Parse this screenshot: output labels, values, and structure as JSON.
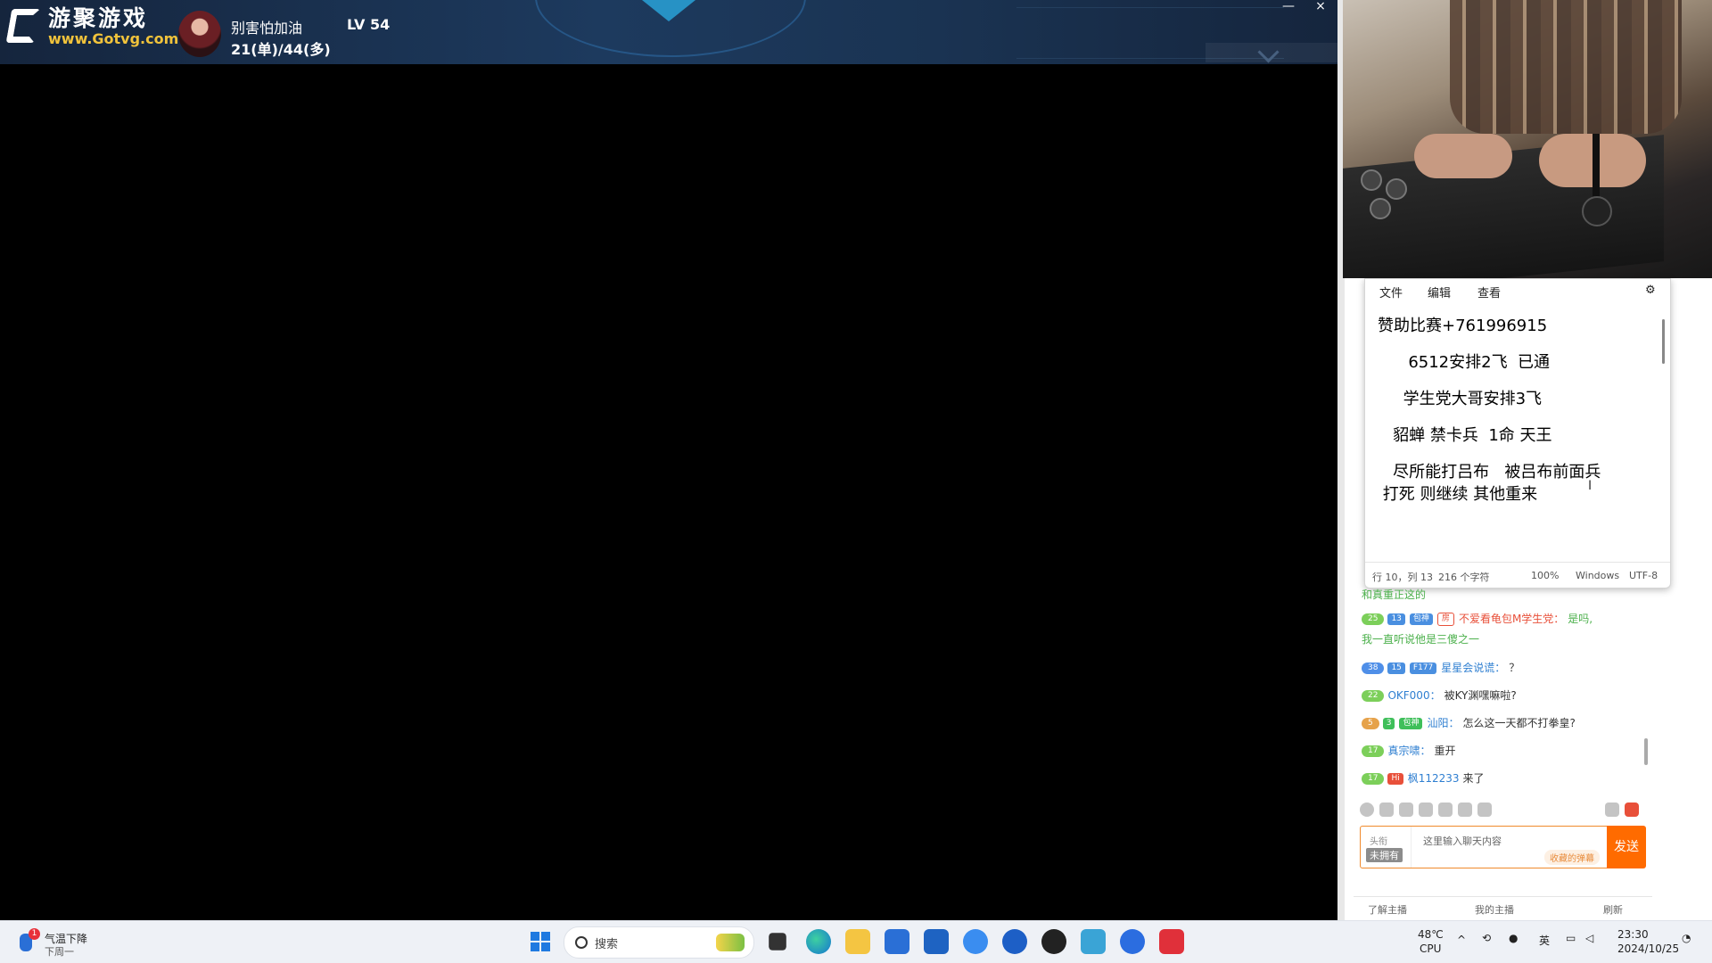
{
  "game": {
    "logo_cn": "游聚游戏",
    "logo_url": "www.Gotvg.com",
    "player_name": "别害怕加油",
    "player_record": "21(单)/44(多)",
    "player_level": "LV 54",
    "minimize_label": "—",
    "close_label": "×"
  },
  "notepad": {
    "menu": [
      "文件",
      "编辑",
      "查看"
    ],
    "lines": [
      "赞助比赛+761996915",
      "      6512安排2飞  已通",
      "     学生党大哥安排3飞",
      "   貂蝉 禁卡兵  1命 天王",
      "   尽所能打吕布   被吕布前面兵",
      " 打死 则继续 其他重来"
    ],
    "status": {
      "position": "行 10，列 13",
      "chars": "216 个字符",
      "zoom": "100%",
      "eol": "Windows",
      "encoding": "UTF-8"
    }
  },
  "chat": {
    "partial_text": "和真重正这的 ",
    "messages": [
      {
        "level": "25",
        "level_color": "#7ccf5a",
        "fan_level": "13",
        "fan_name": "包神",
        "fan_color": "#4a8fe0",
        "room_badge": "房",
        "user": "不爱看龟包M学生党：",
        "user_color": "#e8503a",
        "text": "是吗,",
        "text_color": "#e8503a",
        "text2": "我一直听说他是三傻之一",
        "text2_color": "#4bb04b"
      },
      {
        "level": "38",
        "level_color": "#4f8fe8",
        "fan_level": "15",
        "fan_name": "F177",
        "fan_color": "#4a8fe0",
        "user": "星星会说谎：",
        "user_color": "#2f7fd1",
        "text": "？",
        "text_color": "#333"
      },
      {
        "level": "22",
        "level_color": "#7ccf5a",
        "user": "OKF000：",
        "user_color": "#2f7fd1",
        "text": "被KY渊嘿嘛啦?",
        "text_color": "#333"
      },
      {
        "level": "5",
        "level_color": "#e6a24a",
        "fan_level": "3",
        "fan_name": "包神",
        "fan_color": "#3fbf5a",
        "user": "汕阳：",
        "user_color": "#2f7fd1",
        "text": "怎么这一天都不打拳皇?",
        "text_color": "#333"
      },
      {
        "level": "17",
        "level_color": "#7ccf5a",
        "user": "真宗啸：",
        "user_color": "#2f7fd1",
        "text": "重开",
        "text_color": "#333"
      },
      {
        "level": "17",
        "level_color": "#7ccf5a",
        "hi_badge": "Hi",
        "user": "枫112233",
        "user_color": "#2f7fd1",
        "text": "来了",
        "text_color": "#333"
      }
    ],
    "input_placeholder": "这里输入聊天内容",
    "input_left_top": "头衔",
    "input_left_badge": "未拥有",
    "input_tag": "收藏的弹幕",
    "send_label": "发送",
    "bottom_tab_1": "了解主播",
    "bottom_tab_2": "我的主播",
    "bottom_tab_3": "刷新"
  },
  "taskbar": {
    "weather_badge": "1",
    "weather_line1": "气温下降",
    "weather_line2": "下周一",
    "search_placeholder": "搜索",
    "cpu_temp": "48℃",
    "cpu_label": "CPU",
    "ime": "英",
    "time": "23:30",
    "date": "2024/10/25"
  }
}
